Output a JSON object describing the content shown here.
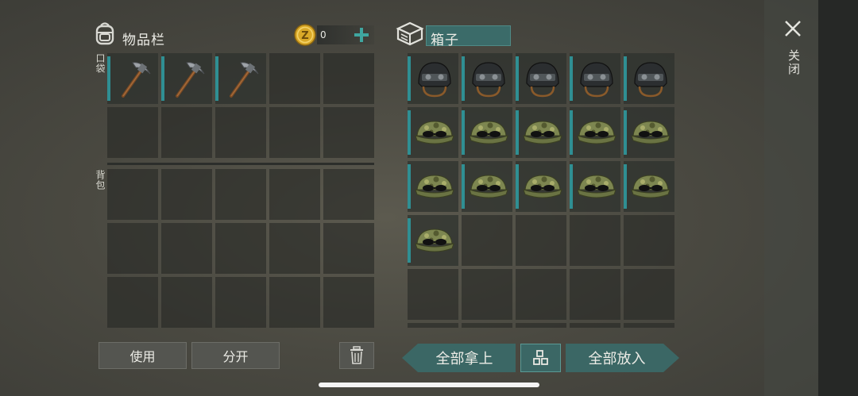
{
  "inventory": {
    "title": "物品栏",
    "coins": "0",
    "pocket_label": "口袋",
    "backpack_label": "背包",
    "pocket_slots": [
      "pickaxe",
      "pickaxe",
      "pickaxe",
      "",
      "",
      "",
      "",
      "",
      "",
      ""
    ],
    "backpack_slots": [
      "",
      "",
      "",
      "",
      "",
      "",
      "",
      "",
      "",
      "",
      "",
      "",
      "",
      "",
      ""
    ]
  },
  "box": {
    "title": "箱子",
    "slots": [
      "helmet",
      "helmet",
      "helmet",
      "helmet",
      "helmet",
      "cap",
      "cap",
      "cap",
      "cap",
      "cap",
      "cap",
      "cap",
      "cap",
      "cap",
      "cap",
      "cap",
      "",
      "",
      "",
      "",
      "",
      "",
      "",
      "",
      "",
      "",
      "",
      "",
      "",
      ""
    ]
  },
  "buttons": {
    "use": "使用",
    "split": "分开",
    "take_all": "全部拿上",
    "put_all": "全部放入"
  },
  "close": {
    "label": "关闭"
  },
  "icons": {
    "backpack": "backpack-icon",
    "coin": "coin-icon",
    "add": "plus-icon",
    "box": "box-icon",
    "trash": "trash-icon",
    "sort": "grid-sort-icon",
    "close": "close-icon"
  },
  "colors": {
    "accent": "#2f8f93",
    "button_teal": "#3b6765",
    "coin": "#d9a928"
  }
}
